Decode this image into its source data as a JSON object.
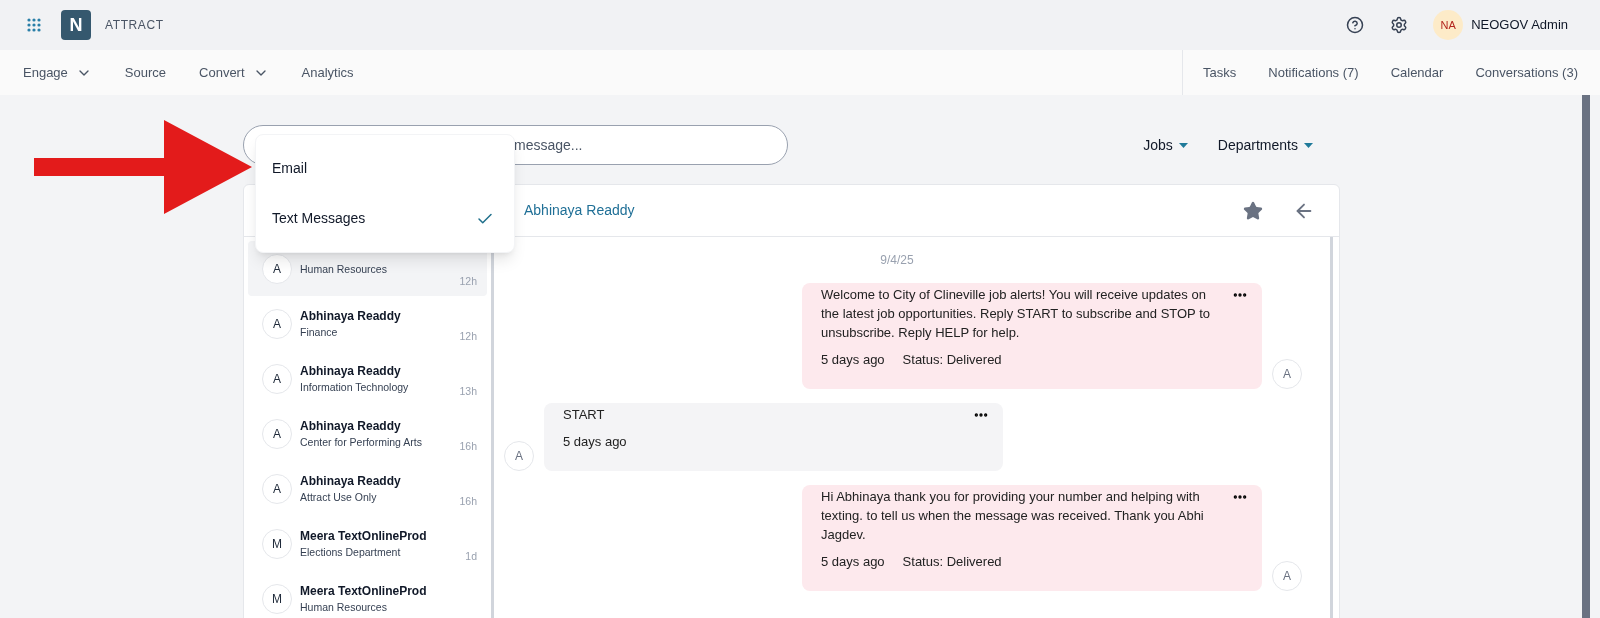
{
  "app": {
    "logo_letter": "N",
    "name": "ATTRACT"
  },
  "user": {
    "initials": "NA",
    "name": "NEOGOV Admin"
  },
  "nav_left": [
    {
      "label": "Engage",
      "has_menu": true
    },
    {
      "label": "Source",
      "has_menu": false
    },
    {
      "label": "Convert",
      "has_menu": true
    },
    {
      "label": "Analytics",
      "has_menu": false
    }
  ],
  "nav_right": [
    "Tasks",
    "Notifications (7)",
    "Calendar",
    "Conversations (3)"
  ],
  "search": {
    "placeholder": "message..."
  },
  "channel_menu": [
    {
      "label": "Email",
      "selected": false
    },
    {
      "label": "Text Messages",
      "selected": true
    }
  ],
  "filters": [
    "Jobs",
    "Departments"
  ],
  "conversations": [
    {
      "initial": "A",
      "department": "Human Resources",
      "time": "12h",
      "selected": true
    },
    {
      "initial": "A",
      "name": "Abhinaya Readdy",
      "department": "Finance",
      "time": "12h",
      "selected": false
    },
    {
      "initial": "A",
      "name": "Abhinaya Readdy",
      "department": "Information Technology",
      "time": "13h",
      "selected": false
    },
    {
      "initial": "A",
      "name": "Abhinaya Readdy",
      "department": "Center for Performing Arts",
      "time": "16h",
      "selected": false
    },
    {
      "initial": "A",
      "name": "Abhinaya Readdy",
      "department": "Attract Use Only",
      "time": "16h",
      "selected": false
    },
    {
      "initial": "M",
      "name": "Meera TextOnlineProd",
      "department": "Elections Department",
      "time": "1d",
      "selected": false
    },
    {
      "initial": "M",
      "name": "Meera TextOnlineProd",
      "department": "Human Resources",
      "selected": false
    }
  ],
  "thread": {
    "contact": "Abhinaya Readdy",
    "date": "9/4/25",
    "messages": [
      {
        "kind": "outgoing",
        "avatar": "A",
        "text": "Welcome to City of Clineville job alerts! You will receive updates on the latest job opportunities. Reply START to subscribe and STOP to unsubscribe. Reply HELP for help.",
        "time": "5 days ago",
        "status": "Status: Delivered"
      },
      {
        "kind": "incoming",
        "avatar": "A",
        "text": "START",
        "time": "5 days ago"
      },
      {
        "kind": "outgoing",
        "avatar": "A",
        "text": "Hi Abhinaya thank you for providing your number and helping with texting. to tell us when the message was received. Thank you Abhi Jagdev.",
        "time": "5 days ago",
        "status": "Status: Delivered"
      }
    ]
  }
}
